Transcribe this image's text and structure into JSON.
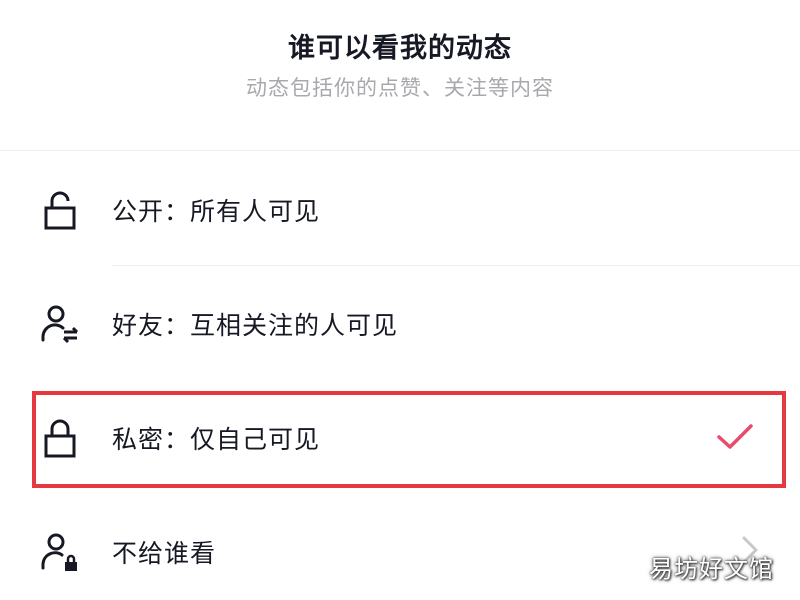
{
  "header": {
    "title": "谁可以看我的动态",
    "subtitle": "动态包括你的点赞、关注等内容"
  },
  "options": [
    {
      "label": "公开：所有人可见",
      "icon": "unlock-icon",
      "selected": false
    },
    {
      "label": "好友：互相关注的人可见",
      "icon": "mutual-follow-user-icon",
      "selected": false
    },
    {
      "label": "私密：仅自己可见",
      "icon": "lock-icon",
      "selected": true
    },
    {
      "label": "不给谁看",
      "icon": "user-lock-icon",
      "selected": false
    }
  ],
  "colors": {
    "check": "#ea4a6b",
    "highlight_border": "#e8383f",
    "text_primary": "#161823",
    "text_secondary": "#a8a9ad"
  },
  "watermark": "易坊好文馆"
}
